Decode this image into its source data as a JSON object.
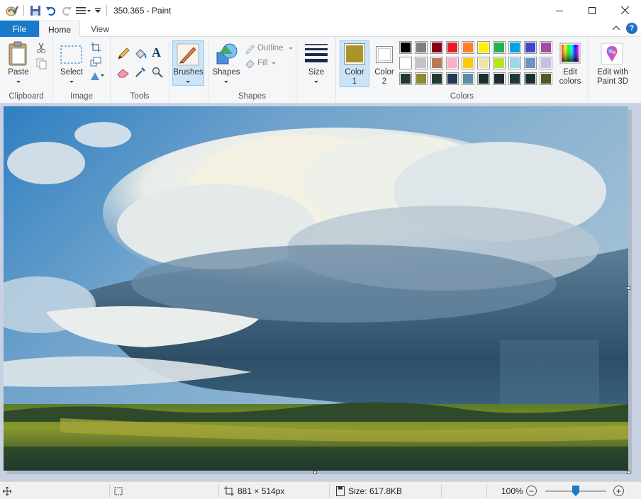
{
  "window": {
    "title": "350.365 - Paint"
  },
  "tabs": [
    {
      "label": "File"
    },
    {
      "label": "Home"
    },
    {
      "label": "View"
    }
  ],
  "help_label": "?",
  "ribbon": {
    "clipboard": {
      "group_label": "Clipboard",
      "paste_label": "Paste"
    },
    "image": {
      "group_label": "Image",
      "select_label": "Select"
    },
    "tools": {
      "group_label": "Tools",
      "text_tool": "A"
    },
    "brushes": {
      "label": "Brushes"
    },
    "shapes": {
      "group_label": "Shapes",
      "shapes_label": "Shapes",
      "outline_label": "Outline",
      "fill_label": "Fill"
    },
    "size": {
      "label": "Size"
    },
    "colors": {
      "group_label": "Colors",
      "color1_label_a": "Color",
      "color1_label_b": "1",
      "color2_label_a": "Color",
      "color2_label_b": "2",
      "color1_value": "#a8952a",
      "color2_value": "#ffffff",
      "edit_label_a": "Edit",
      "edit_label_b": "colors",
      "palette": [
        [
          "#000000",
          "#7f7f7f",
          "#880015",
          "#ed1c24",
          "#ff7f27",
          "#fff200",
          "#22b14c",
          "#00a2e8",
          "#3f48cc",
          "#a349a4"
        ],
        [
          "#ffffff",
          "#c3c3c3",
          "#b97a57",
          "#ffaec9",
          "#ffc90e",
          "#efe4b0",
          "#b5e61d",
          "#99d9ea",
          "#7092be",
          "#c8bfe7"
        ],
        [
          "#213a2b",
          "#8c8a35",
          "#1d3a31",
          "#1e3a54",
          "#5f8ba3",
          "#1c2e2a",
          "#1d2b2f",
          "#1f3838",
          "#1a2e2c",
          "#4d5a22"
        ]
      ]
    },
    "paint3d": {
      "label_a": "Edit with",
      "label_b": "Paint 3D"
    }
  },
  "status": {
    "canvas_size": "881 × 514px",
    "file_size": "Size: 617.8KB",
    "zoom": "100%"
  },
  "colors": {
    "accent": "#1979ca",
    "workspace": "#c8d1e1"
  }
}
